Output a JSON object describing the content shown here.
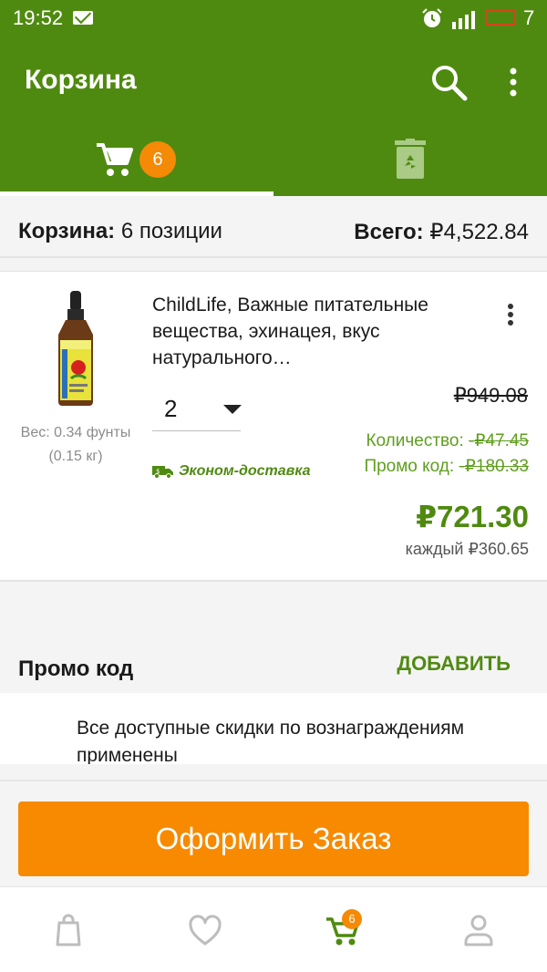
{
  "status_bar": {
    "time": "19:52",
    "battery_percent": "7"
  },
  "app_bar": {
    "title": "Корзина",
    "cart_tab_badge": "6"
  },
  "summary": {
    "label": "Корзина:",
    "count_text": "6 позиции",
    "total_label": "Всего:",
    "total_value": "₽4,522.84"
  },
  "product": {
    "title": "ChildLife, Важные питательные вещества, эхинацея, вкус натурального…",
    "weight_lb": "Вес: 0.34 фунты",
    "weight_kg": "(0.15 кг)",
    "quantity": "2",
    "price_original": "₽949.08",
    "discount_qty_label": "Количество:",
    "discount_qty_value": "-₽47.45",
    "discount_promo_label": "Промо код:",
    "discount_promo_value": "-₽180.33",
    "shipping": "Эконом-доставка",
    "price_final": "₽721.30",
    "price_each_label": "каждый",
    "price_each_value": "₽360.65"
  },
  "promo": {
    "title": "Промо код",
    "add_label": "ДОБАВИТЬ",
    "rewards_text": "Все доступные скидки по вознаграждениям применены"
  },
  "checkout": {
    "button_label": "Оформить Заказ"
  },
  "bottom_nav": {
    "cart_badge": "6"
  },
  "colors": {
    "brand_green": "#4f8a10",
    "accent_orange": "#f78a00",
    "discount_green": "#5f9e1f"
  }
}
